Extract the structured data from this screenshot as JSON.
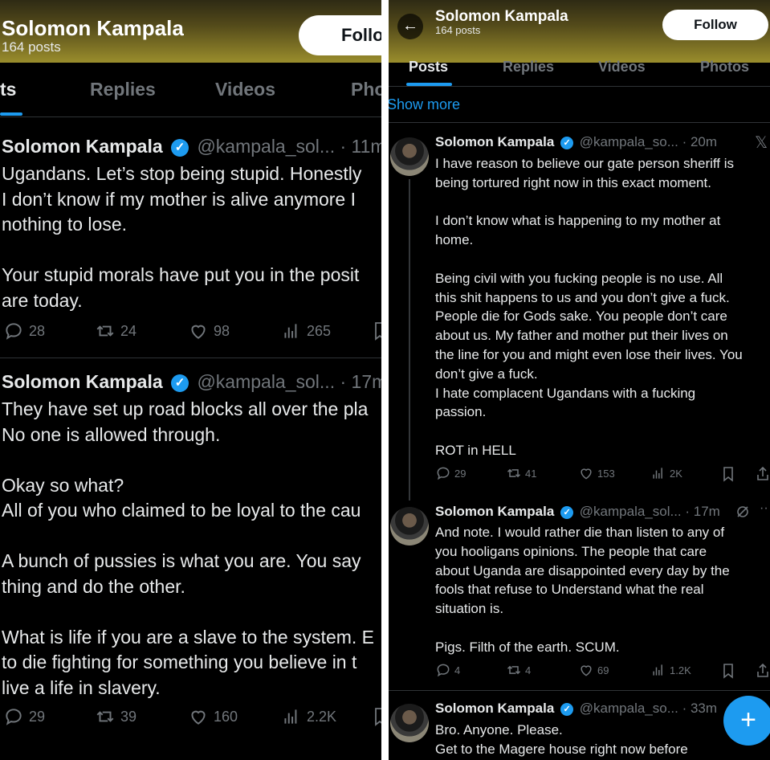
{
  "profile": {
    "name": "Solomon Kampala",
    "posts": "164 posts",
    "follow_label": "Follow"
  },
  "left": {
    "header": {
      "name": "Solomon Kampala",
      "posts": "164 posts",
      "follow_label": "Follo"
    },
    "tabs": [
      "ts",
      "Replies",
      "Videos",
      "Pho"
    ],
    "tweets": [
      {
        "name": "Solomon Kampala",
        "meta": "@kampala_sol... · 11m",
        "text": "Ugandans. Let’s stop being stupid. Honestly\nI don’t know if my mother is alive anymore I\nnothing to lose.\n\nYour stupid morals have put you in the posit\nare today.",
        "replies": "28",
        "reposts": "24",
        "likes": "98",
        "views": "265"
      },
      {
        "name": "Solomon Kampala",
        "meta": "@kampala_sol... · 17m",
        "text": "They have set up road blocks all over the pla\nNo one is allowed through.\n\nOkay so what?\nAll of you who claimed to be loyal to the cau\n\nA bunch of pussies is what you are. You say\nthing and do the other.\n\nWhat is life if you are a slave to the system. E\nto die fighting for something you believe in t\nlive a life in slavery.",
        "replies": "29",
        "reposts": "39",
        "likes": "160",
        "views": "2.2K"
      }
    ]
  },
  "right": {
    "header": {
      "name": "Solomon Kampala",
      "posts": "164 posts",
      "follow_label": "Follow"
    },
    "tabs": [
      "Posts",
      "Replies",
      "Videos",
      "Photos"
    ],
    "show_more": "Show more",
    "tweets": [
      {
        "name": "Solomon Kampala",
        "meta": "@kampala_so... · 20m",
        "text": "I have reason to believe our gate person sheriff is\nbeing tortured right now in this exact moment.\n\nI don’t know what is happening to my mother at\nhome.\n\nBeing civil with you fucking people is no use. All\nthis shit happens to us and you don’t give a fuck.\nPeople die for Gods sake. You people don’t care\nabout us. My father and mother put their lives on\nthe line for you and might even lose their lives. You\ndon’t give a fuck.\nI hate complacent Ugandans with a fucking\npassion.\n\nROT in HELL",
        "replies": "29",
        "reposts": "41",
        "likes": "153",
        "views": "2K"
      },
      {
        "name": "Solomon Kampala",
        "meta": "@kampala_sol... · 17m",
        "text": "And note. I would rather die than listen to any of\nyou hooligans opinions. The people that care\nabout Uganda are disappointed every day by the\nfools that refuse to Understand what the real\nsituation is.\n\nPigs. Filth of the earth. SCUM.",
        "replies": "4",
        "reposts": "4",
        "likes": "69",
        "views": "1.2K"
      },
      {
        "name": "Solomon Kampala",
        "meta": "@kampala_so... · 33m",
        "text": "Bro. Anyone. Please.\nGet to the Magere house right now before"
      }
    ],
    "fab_label": "+"
  },
  "colors": {
    "accent": "#1d9bf0",
    "muted": "#71767b",
    "text": "#e7e9ea",
    "bg": "#000000"
  }
}
